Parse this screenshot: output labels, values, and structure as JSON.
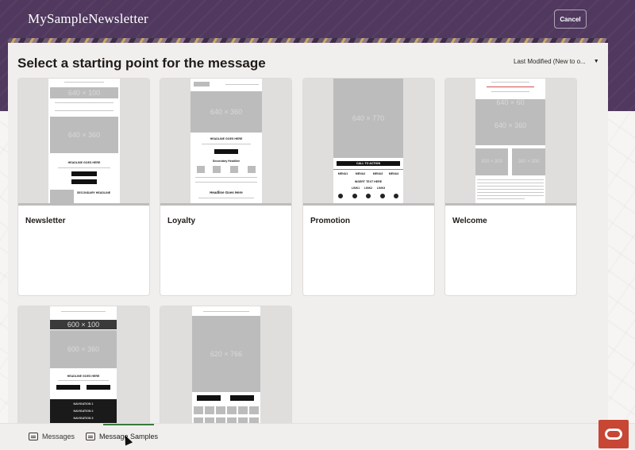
{
  "header": {
    "app_title": "MySampleNewsletter",
    "cancel_label": "Cancel"
  },
  "panel": {
    "title": "Select a starting point for the message",
    "sort_label": "Last Modified (New to o..."
  },
  "templates": [
    {
      "label": "Newsletter",
      "thumb": {
        "ph1": "640 × 100",
        "ph2": "640 × 360",
        "headline": "HEADLINE GOES HERE",
        "secondary": "SECONDARY HEADLINE"
      }
    },
    {
      "label": "Loyalty",
      "thumb": {
        "ph1": "640 × 360",
        "headline": "HEADLINE GOES HERE",
        "sub": "Secondary Headline",
        "headline2": "Headline Goes Here"
      }
    },
    {
      "label": "Promotion",
      "thumb": {
        "ph1": "640 × 770",
        "cta": "CALL TO ACTION",
        "menu": [
          "MENU1",
          "MENU2",
          "MENU3",
          "MENU4"
        ],
        "insert": "INSERT TEXT HERE",
        "links": [
          "LINK1",
          "LINK2",
          "LINK3"
        ]
      }
    },
    {
      "label": "Welcome",
      "thumb": {
        "ph1": "640 × 60",
        "ph2": "640 × 360",
        "ph3": "300 × 300",
        "ph4": "300 × 300"
      }
    },
    {
      "label": "",
      "thumb": {
        "ph1": "600 × 100",
        "ph2": "600 × 360",
        "headline": "HEADLINE GOES HERE",
        "nav": [
          "NAVIGATION 1",
          "NAVIGATION 2",
          "NAVIGATION 3"
        ]
      }
    },
    {
      "label": "",
      "thumb": {
        "ph1": "620 × 766",
        "cta": "CALL TO ACTION"
      }
    }
  ],
  "bottom_tabs": [
    {
      "label": "Messages"
    },
    {
      "label": "Message Samples"
    }
  ],
  "colors": {
    "header_bg": "#50385e",
    "oracle_red": "#c74634",
    "active_tab_underline": "#3a7a3a"
  }
}
